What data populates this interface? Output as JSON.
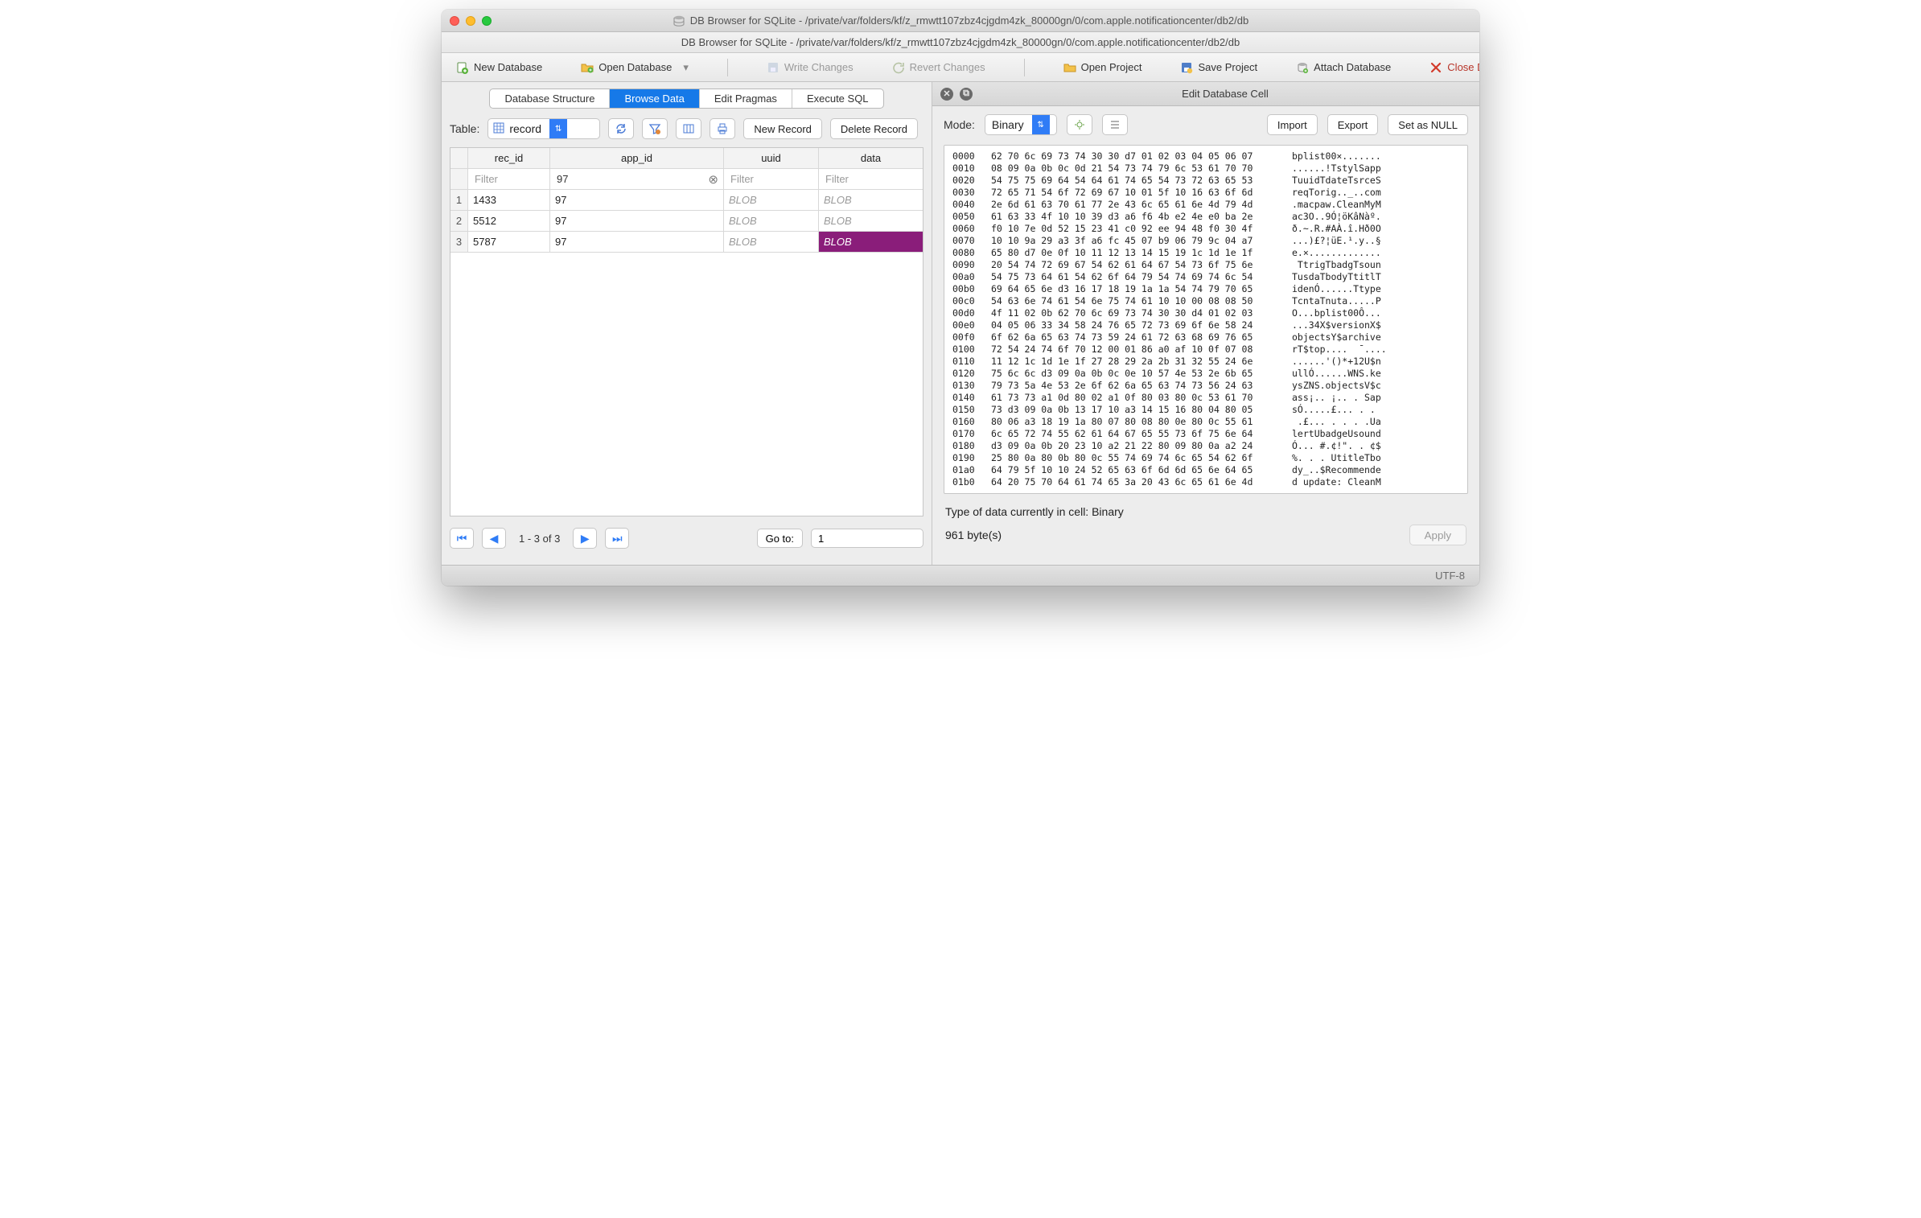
{
  "window": {
    "title1": "DB Browser for SQLite - /private/var/folders/kf/z_rmwtt107zbz4cjgdm4zk_80000gn/0/com.apple.notificationcenter/db2/db",
    "title2": "DB Browser for SQLite - /private/var/folders/kf/z_rmwtt107zbz4cjgdm4zk_80000gn/0/com.apple.notificationcenter/db2/db"
  },
  "toolbar": {
    "new_db": "New Database",
    "open_db": "Open Database",
    "write": "Write Changes",
    "revert": "Revert Changes",
    "open_proj": "Open Project",
    "save_proj": "Save Project",
    "attach": "Attach Database",
    "close": "Close Database"
  },
  "tabs": {
    "structure": "Database Structure",
    "browse": "Browse Data",
    "pragmas": "Edit Pragmas",
    "sql": "Execute SQL",
    "active": "browse"
  },
  "browse": {
    "table_label": "Table:",
    "table_value": "record",
    "new_record": "New Record",
    "delete_record": "Delete Record",
    "columns": [
      "rec_id",
      "app_id",
      "uuid",
      "data"
    ],
    "filter_placeholder": "Filter",
    "filters": {
      "rec_id": "",
      "app_id": "97",
      "uuid": "",
      "data": ""
    },
    "rows": [
      {
        "n": "1",
        "rec_id": "1433",
        "app_id": "97",
        "uuid": "BLOB",
        "data": "BLOB"
      },
      {
        "n": "2",
        "rec_id": "5512",
        "app_id": "97",
        "uuid": "BLOB",
        "data": "BLOB"
      },
      {
        "n": "3",
        "rec_id": "5787",
        "app_id": "97",
        "uuid": "BLOB",
        "data": "BLOB"
      }
    ],
    "selected": {
      "row": 2,
      "col": "data"
    },
    "pager": {
      "range": "1 - 3 of 3",
      "goto_label": "Go to:",
      "goto_value": "1"
    }
  },
  "editor": {
    "title": "Edit Database Cell",
    "mode_label": "Mode:",
    "mode_value": "Binary",
    "import": "Import",
    "export": "Export",
    "null": "Set as NULL",
    "hex": [
      {
        "off": "0000",
        "b": "62 70 6c 69 73 74 30 30 d7 01 02 03 04 05 06 07",
        "a": "bplist00×......."
      },
      {
        "off": "0010",
        "b": "08 09 0a 0b 0c 0d 21 54 73 74 79 6c 53 61 70 70",
        "a": "......!TstylSapp"
      },
      {
        "off": "0020",
        "b": "54 75 75 69 64 54 64 61 74 65 54 73 72 63 65 53",
        "a": "TuuidTdateTsrceS"
      },
      {
        "off": "0030",
        "b": "72 65 71 54 6f 72 69 67 10 01 5f 10 16 63 6f 6d",
        "a": "reqTorig.._..com"
      },
      {
        "off": "0040",
        "b": "2e 6d 61 63 70 61 77 2e 43 6c 65 61 6e 4d 79 4d",
        "a": ".macpaw.CleanMyM"
      },
      {
        "off": "0050",
        "b": "61 63 33 4f 10 10 39 d3 a6 f6 4b e2 4e e0 ba 2e",
        "a": "ac3O..9Ó¦öKâNàº."
      },
      {
        "off": "0060",
        "b": "f0 10 7e 0d 52 15 23 41 c0 92 ee 94 48 f0 30 4f",
        "a": "ð.~.R.#AÀ.î.Hð0O"
      },
      {
        "off": "0070",
        "b": "10 10 9a 29 a3 3f a6 fc 45 07 b9 06 79 9c 04 a7",
        "a": "...)£?¦üE.¹.y..§"
      },
      {
        "off": "0080",
        "b": "65 80 d7 0e 0f 10 11 12 13 14 15 19 1c 1d 1e 1f",
        "a": "e.×............."
      },
      {
        "off": "0090",
        "b": "20 54 74 72 69 67 54 62 61 64 67 54 73 6f 75 6e",
        "a": " TtrigTbadgTsoun"
      },
      {
        "off": "00a0",
        "b": "54 75 73 64 61 54 62 6f 64 79 54 74 69 74 6c 54",
        "a": "TusdaTbodyTtitlT"
      },
      {
        "off": "00b0",
        "b": "69 64 65 6e d3 16 17 18 19 1a 1a 54 74 79 70 65",
        "a": "idenÓ......Ttype"
      },
      {
        "off": "00c0",
        "b": "54 63 6e 74 61 54 6e 75 74 61 10 10 00 08 08 50",
        "a": "TcntaTnuta.....P"
      },
      {
        "off": "00d0",
        "b": "4f 11 02 0b 62 70 6c 69 73 74 30 30 d4 01 02 03",
        "a": "O...bplist00Ô..."
      },
      {
        "off": "00e0",
        "b": "04 05 06 33 34 58 24 76 65 72 73 69 6f 6e 58 24",
        "a": "...34X$versionX$"
      },
      {
        "off": "00f0",
        "b": "6f 62 6a 65 63 74 73 59 24 61 72 63 68 69 76 65",
        "a": "objectsY$archive"
      },
      {
        "off": "0100",
        "b": "72 54 24 74 6f 70 12 00 01 86 a0 af 10 0f 07 08",
        "a": "rT$top....  ¯...."
      },
      {
        "off": "0110",
        "b": "11 12 1c 1d 1e 1f 27 28 29 2a 2b 31 32 55 24 6e",
        "a": "......'()*+12U$n"
      },
      {
        "off": "0120",
        "b": "75 6c 6c d3 09 0a 0b 0c 0e 10 57 4e 53 2e 6b 65",
        "a": "ullÓ......WNS.ke"
      },
      {
        "off": "0130",
        "b": "79 73 5a 4e 53 2e 6f 62 6a 65 63 74 73 56 24 63",
        "a": "ysZNS.objectsV$c"
      },
      {
        "off": "0140",
        "b": "61 73 73 a1 0d 80 02 a1 0f 80 03 80 0c 53 61 70",
        "a": "ass¡.. ¡.. . Sap"
      },
      {
        "off": "0150",
        "b": "73 d3 09 0a 0b 13 17 10 a3 14 15 16 80 04 80 05",
        "a": "sÓ.....£... . ."
      },
      {
        "off": "0160",
        "b": "80 06 a3 18 19 1a 80 07 80 08 80 0e 80 0c 55 61",
        "a": " .£... . . . .Ua"
      },
      {
        "off": "0170",
        "b": "6c 65 72 74 55 62 61 64 67 65 55 73 6f 75 6e 64",
        "a": "lertUbadgeUsound"
      },
      {
        "off": "0180",
        "b": "d3 09 0a 0b 20 23 10 a2 21 22 80 09 80 0a a2 24",
        "a": "Ó... #.¢!\". . ¢$"
      },
      {
        "off": "0190",
        "b": "25 80 0a 80 0b 80 0c 55 74 69 74 6c 65 54 62 6f",
        "a": "%. . . UtitleTbo"
      },
      {
        "off": "01a0",
        "b": "64 79 5f 10 10 24 52 65 63 6f 6d 6d 65 6e 64 65",
        "a": "dy_..$Recommende"
      },
      {
        "off": "01b0",
        "b": "64 20 75 70 64 61 74 65 3a 20 43 6c 65 61 6e 4d",
        "a": "d update: CleanM"
      }
    ],
    "status1": "Type of data currently in cell: Binary",
    "status2": "961 byte(s)",
    "apply": "Apply"
  },
  "statusbar": {
    "encoding": "UTF-8"
  }
}
